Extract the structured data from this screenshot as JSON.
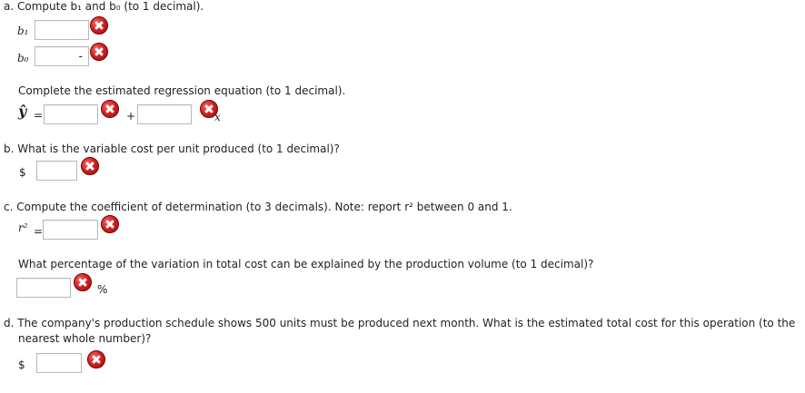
{
  "part_a": {
    "question": "a. Compute b₁ and b₀ (to 1 decimal).",
    "b1_label": "b₁",
    "b0_label": "b₀",
    "b0_value": "-",
    "eq_prompt": "Complete the estimated regression equation (to 1 decimal).",
    "yhat": "ŷ",
    "equals": "=",
    "plus": "+",
    "x": "x"
  },
  "part_b": {
    "question": "b. What is the variable cost per unit produced (to 1 decimal)?",
    "currency": "$"
  },
  "part_c": {
    "question": "c. Compute the coefficient of determination (to 3 decimals). Note: report r² between 0 and 1.",
    "r2_label": "r²",
    "equals": "=",
    "pct_prompt": "What percentage of the variation in total cost can be explained by the production volume (to 1 decimal)?",
    "percent": "%"
  },
  "part_d": {
    "question_line1": "d. The company's production schedule shows 500 units must be produced next month. What is the estimated total cost for this operation (to the",
    "question_line2": "nearest whole number)?",
    "currency": "$"
  }
}
